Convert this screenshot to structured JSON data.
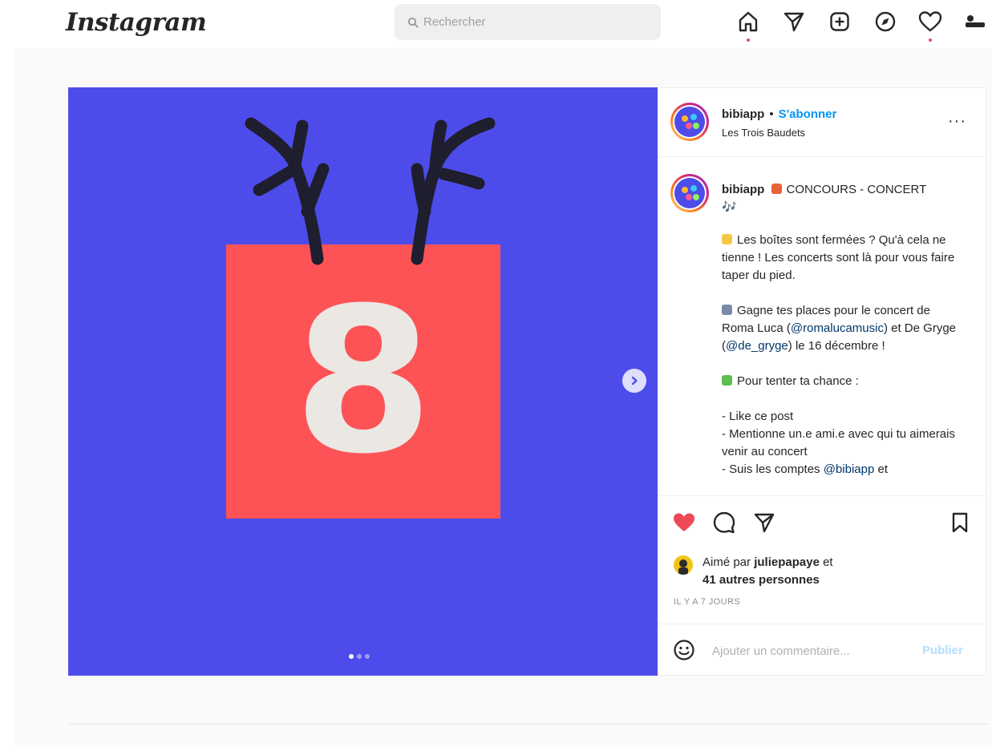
{
  "app": {
    "logo": "Instagram"
  },
  "search": {
    "placeholder": "Rechercher"
  },
  "nav": {
    "items": [
      "home-icon",
      "direct-icon",
      "new-post-icon",
      "explore-icon",
      "activity-icon",
      "profile-icon"
    ],
    "accent": "#ed4956"
  },
  "post": {
    "media": {
      "background": "#4d4ceb",
      "box_color": "#fd5356",
      "number": "8",
      "slide_count": 3,
      "active_slide": 1
    },
    "header": {
      "username": "bibiapp",
      "separator": "•",
      "follow": "S'abonner",
      "location": "Les Trois Baudets",
      "more": "···"
    },
    "caption": {
      "username": "bibiapp",
      "title": "CONCOURS - CONCERT",
      "title_suffix": "🎶",
      "p1": "Les boîtes sont fermées ? Qu'à cela ne tienne ! Les concerts sont là pour vous faire taper du pied.",
      "p2_a": "Gagne tes places pour le concert de Roma Luca (",
      "p2_m1": "@romalucamusic",
      "p2_b": ") et De Gryge (",
      "p2_m2": "@de_gryge",
      "p2_c": ") le 16 décembre !",
      "p3": "Pour tenter ta chance :",
      "l1": "- Like ce post",
      "l2": "- Mentionne un.e ami.e avec qui tu aimerais venir au concert",
      "l3_a": "- Suis les comptes ",
      "l3_m": "@bibiapp",
      "l3_b": " et"
    },
    "likes": {
      "prefix": "Aimé par ",
      "user": "juliepapaye",
      "suffix": " et",
      "others": "41 autres personnes"
    },
    "timestamp": "IL Y A 7 JOURS",
    "comment": {
      "placeholder": "Ajouter un commentaire...",
      "publish": "Publier"
    }
  }
}
